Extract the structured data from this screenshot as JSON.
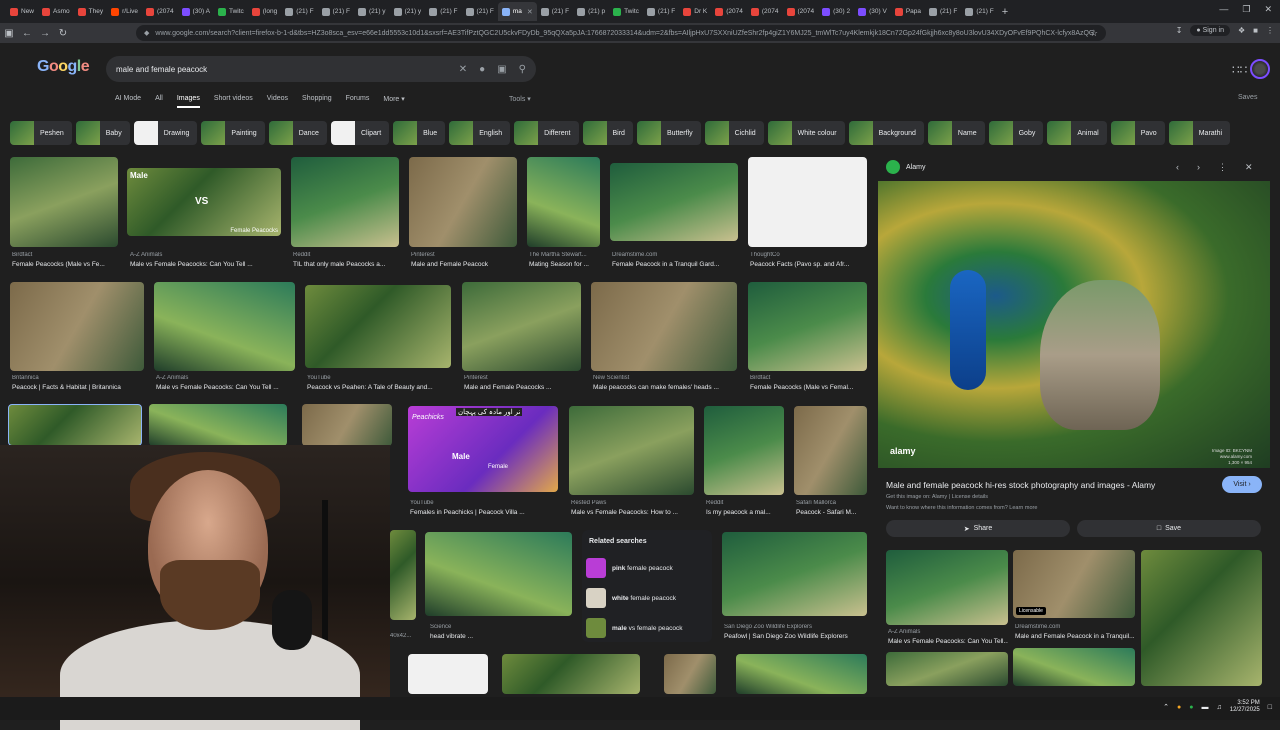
{
  "browser": {
    "tabs": [
      {
        "label": "New",
        "color": "#e8453c"
      },
      {
        "label": "Asmo",
        "color": "#e8453c"
      },
      {
        "label": "They",
        "color": "#e8453c"
      },
      {
        "label": "r/Live",
        "color": "#ff4500"
      },
      {
        "label": "(2074",
        "color": "#e8453c"
      },
      {
        "label": "(30) A",
        "color": "#7c4dff"
      },
      {
        "label": "Twitc",
        "color": "#2bb24c"
      },
      {
        "label": "(long",
        "color": "#e8453c"
      },
      {
        "label": "(21) F",
        "color": "#9aa0a6"
      },
      {
        "label": "(21) F",
        "color": "#9aa0a6"
      },
      {
        "label": "(21) y",
        "color": "#9aa0a6"
      },
      {
        "label": "(21) y",
        "color": "#9aa0a6"
      },
      {
        "label": "(21) F",
        "color": "#9aa0a6"
      },
      {
        "label": "(21) F",
        "color": "#9aa0a6"
      },
      {
        "label": "ma",
        "color": "#8ab4f8",
        "active": true
      },
      {
        "label": "(21) F",
        "color": "#9aa0a6"
      },
      {
        "label": "(21) p",
        "color": "#9aa0a6"
      },
      {
        "label": "Twitc",
        "color": "#2bb24c"
      },
      {
        "label": "(21) F",
        "color": "#9aa0a6"
      },
      {
        "label": "Dr K",
        "color": "#e8453c"
      },
      {
        "label": "(2074",
        "color": "#e8453c"
      },
      {
        "label": "(2074",
        "color": "#e8453c"
      },
      {
        "label": "(2074",
        "color": "#e8453c"
      },
      {
        "label": "(30) 2",
        "color": "#7c4dff"
      },
      {
        "label": "(30) V",
        "color": "#7c4dff"
      },
      {
        "label": "Papa",
        "color": "#e8453c"
      },
      {
        "label": "(21) F",
        "color": "#9aa0a6"
      },
      {
        "label": "(21) F",
        "color": "#9aa0a6"
      }
    ],
    "url": "www.google.com/search?client=firefox-b-1-d&tbs=HZ3o8sca_esv=e66e1dd5553c10d1&sxsrf=AE3TifPztQGC2U5ckvFDyDb_95qQXa5pJA:1766872033314&udm=2&fbs=AIljpHxU7SXXniUZfeShr2fp4giZ1Y6MJ25_tmWlTc7uy4Klemkjk18Cn72Gp24fGkjjh6xc8y8oU3lovU34XDyOFvEf9PQhCX-lcfyx8AzQG",
    "signin": "Sign in"
  },
  "google": {
    "logo": "Google",
    "query": "male and female peacock",
    "tabs": [
      "AI Mode",
      "All",
      "Images",
      "Short videos",
      "Videos",
      "Shopping",
      "Forums",
      "More ▾"
    ],
    "active_tab": "Images",
    "tools": "Tools ▾",
    "saves": "Saves"
  },
  "chips": [
    "Peshen",
    "Baby",
    "Drawing",
    "Painting",
    "Dance",
    "Clipart",
    "Blue",
    "English",
    "Different",
    "Bird",
    "Butterfly",
    "Cichlid",
    "White colour",
    "Background",
    "Name",
    "Goby",
    "Animal",
    "Pavo",
    "Marathi"
  ],
  "results": [
    {
      "source": "Birdfact",
      "title": "Female Peacocks (Male vs Fe..."
    },
    {
      "source": "A-Z Animals",
      "title": "Male vs Female Peacocks: Can You Tell ..."
    },
    {
      "source": "Reddit",
      "title": "TIL that only male Peacocks a..."
    },
    {
      "source": "Pinterest",
      "title": "Male and Female Peacock"
    },
    {
      "source": "The Martha Stewart...",
      "title": "Mating Season for ..."
    },
    {
      "source": "Dreamstime.com",
      "title": "Female Peacock in a Tranquil Gard..."
    },
    {
      "source": "ThoughtCo",
      "title": "Peacock Facts (Pavo sp. and Afr..."
    },
    {
      "source": "Britannica",
      "title": "Peacock | Facts & Habitat | Britannica"
    },
    {
      "source": "A-Z Animals",
      "title": "Male vs Female Peacocks: Can You Tell ..."
    },
    {
      "source": "YouTube",
      "title": "Peacock vs Peahen: A Tale of Beauty and..."
    },
    {
      "source": "Pinterest",
      "title": "Male and Female Peacocks ..."
    },
    {
      "source": "New Scientist",
      "title": "Male peacocks can make females' heads ..."
    },
    {
      "source": "Birdfact",
      "title": "Female Peacocks (Male vs Femal..."
    },
    {
      "source": "YouTube",
      "title": "Females in Peachicks | Peacock Villa ..."
    },
    {
      "source": "Rested Paws",
      "title": "Male vs Female Peacocks: How to ..."
    },
    {
      "source": "Reddit",
      "title": "Is my peacock a mal..."
    },
    {
      "source": "Safari Mallorca",
      "title": "Peacock - Safari M..."
    },
    {
      "source": "Science",
      "title": "head vibrate ..."
    },
    {
      "source": "San Diego Zoo Wildlife Explorers",
      "title": "Peafowl | San Diego Zoo Wildlife Explorers"
    }
  ],
  "thumb_text": {
    "male": "Male",
    "vs": "VS",
    "female_peacocks": "Female Peacocks",
    "peachicks": "Peachicks",
    "male2": "Male",
    "female2": "Female",
    "urdu": "نر اور مادہ کی پہچان",
    "partial_cap": "40x42..."
  },
  "related": {
    "title": "Related searches",
    "items": [
      {
        "bold": "pink",
        "rest": " female peacock"
      },
      {
        "bold": "white",
        "rest": " female peacock"
      },
      {
        "bold": "male",
        "rest": " vs female peacock"
      }
    ]
  },
  "panel": {
    "source": "Alamy",
    "title": "Male and female peacock hi-res stock photography and images - Alamy",
    "visit": "Visit ›",
    "line1": "Get this image on: Alamy | License details",
    "line2": "Want to know where this information comes from? Learn more",
    "share": "Share",
    "save": "Save",
    "badge": "alamy",
    "img_id": "Image ID: BKCYNM",
    "img_site": "www.alamy.com",
    "img_size": "1,300 × 954",
    "more": [
      {
        "source": "A-Z Animals",
        "title": "Male vs Female Peacocks: Can You Tell..."
      },
      {
        "source": "Dreamstime.com",
        "title": "Male and Female Peacock in a Tranquil...",
        "badge": "Licensable"
      }
    ]
  },
  "taskbar": {
    "time": "3:52 PM",
    "date": "12/27/2025"
  }
}
